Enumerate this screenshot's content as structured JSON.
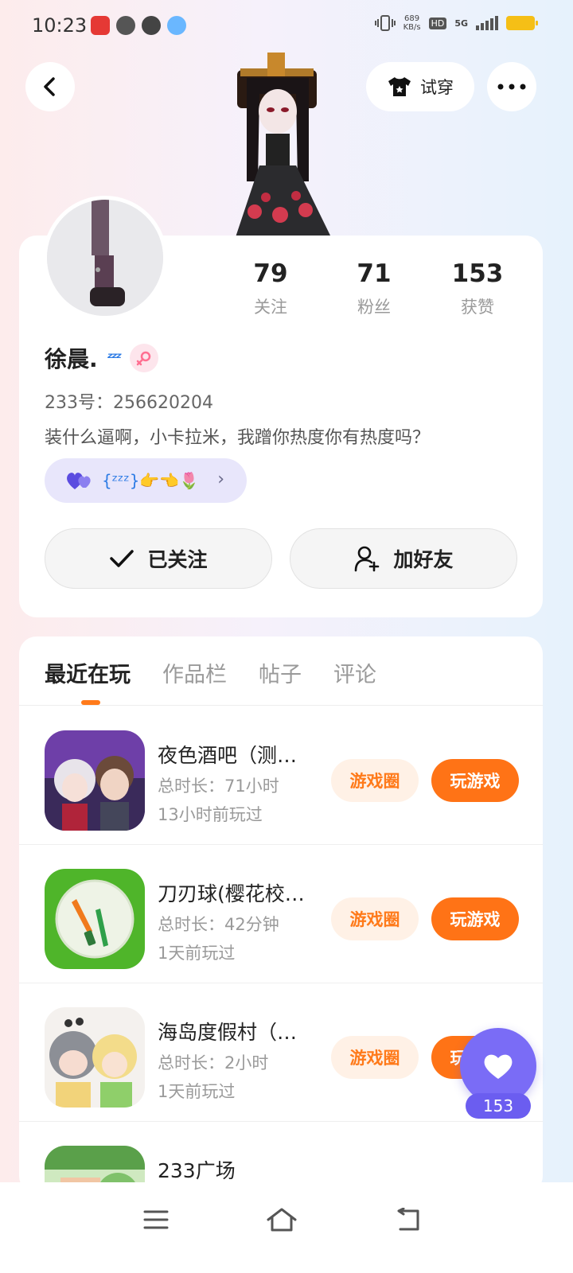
{
  "status_bar": {
    "time": "10:23",
    "net_speed_value": "689",
    "net_speed_unit": "KB/s",
    "hd": "HD",
    "network": "5G"
  },
  "header": {
    "tryon_label": "试穿"
  },
  "profile": {
    "stats": [
      {
        "value": "79",
        "label": "关注"
      },
      {
        "value": "71",
        "label": "粉丝"
      },
      {
        "value": "153",
        "label": "获赞"
      }
    ],
    "name": "徐晨.",
    "uid": "233号：256620204",
    "bio": "装什么逼啊，小卡拉米，我蹭你热度你有热度吗？",
    "badge_text": "{ᶻᶻᶻ}👉👈🌷",
    "follow_label": "已关注",
    "add_friend_label": "加好友"
  },
  "tabs": [
    {
      "label": "最近在玩",
      "active": true
    },
    {
      "label": "作品栏",
      "active": false
    },
    {
      "label": "帖子",
      "active": false
    },
    {
      "label": "评论",
      "active": false
    }
  ],
  "games": [
    {
      "title": "夜色酒吧（测…",
      "duration": "总时长：71小时",
      "last_played": "13小时前玩过",
      "circle_label": "游戏圈",
      "play_label": "玩游戏"
    },
    {
      "title": "刀刃球(樱花校…",
      "duration": "总时长：42分钟",
      "last_played": "1天前玩过",
      "circle_label": "游戏圈",
      "play_label": "玩游戏"
    },
    {
      "title": "海岛度假村（…",
      "duration": "总时长：2小时",
      "last_played": "1天前玩过",
      "circle_label": "游戏圈",
      "play_label": "玩游戏"
    },
    {
      "title": "233广场",
      "duration": "",
      "last_played": "",
      "circle_label": "",
      "play_label": ""
    }
  ],
  "like_fab": {
    "count": "153"
  },
  "colors": {
    "accent_orange": "#ff7316",
    "like_purple": "#7a6cf6"
  }
}
